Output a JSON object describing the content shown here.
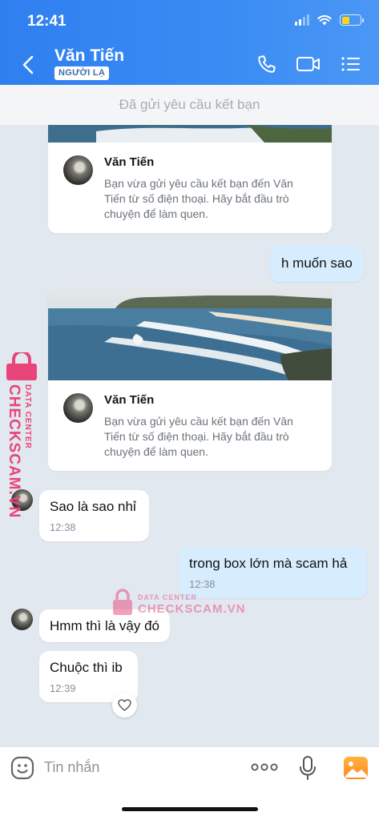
{
  "status_bar": {
    "time": "12:41"
  },
  "header": {
    "contact_name": "Văn Tiến",
    "badge": "NGƯỜI LẠ",
    "icons": [
      "back-arrow-icon",
      "phone-icon",
      "video-call-icon",
      "menu-list-icon"
    ]
  },
  "friend_request_bar": {
    "text": "Đã gửi yêu cầu kết bạn"
  },
  "messages": {
    "card1": {
      "name": "Văn Tiến",
      "text": "Bạn vừa gửi yêu cầu kết bạn đến Văn Tiến từ số điện thoại. Hãy bắt đầu trò chuyện để làm quen."
    },
    "out1": {
      "text": "h muốn sao"
    },
    "card2": {
      "name": "Văn Tiến",
      "text": "Bạn vừa gửi yêu cầu kết bạn đến Văn Tiến từ số điện thoại. Hãy bắt đầu trò chuyện để làm quen."
    },
    "in1": {
      "text": "Sao là sao nhỉ",
      "time": "12:38"
    },
    "out2": {
      "text": "trong box lớn mà scam hả",
      "time": "12:38"
    },
    "in2": {
      "text": "Hmm thì là vậy đó"
    },
    "in3": {
      "text": "Chuộc thì ib",
      "time": "12:39"
    }
  },
  "watermark": {
    "side_line1": "DATA CENTER",
    "side_line2": "CHECKSCAM.VN",
    "mid_line1": "DATA CENTER",
    "mid_line2": "CHECKSCAM.VN"
  },
  "input_bar": {
    "placeholder": "Tin nhắn",
    "icons": [
      "emoji-icon",
      "more-dots-icon",
      "microphone-icon",
      "gallery-icon"
    ]
  },
  "colors": {
    "header_blue": "#3a8cf3",
    "outgoing_bubble": "#d7ecfd",
    "watermark_pink": "#e8457a"
  }
}
